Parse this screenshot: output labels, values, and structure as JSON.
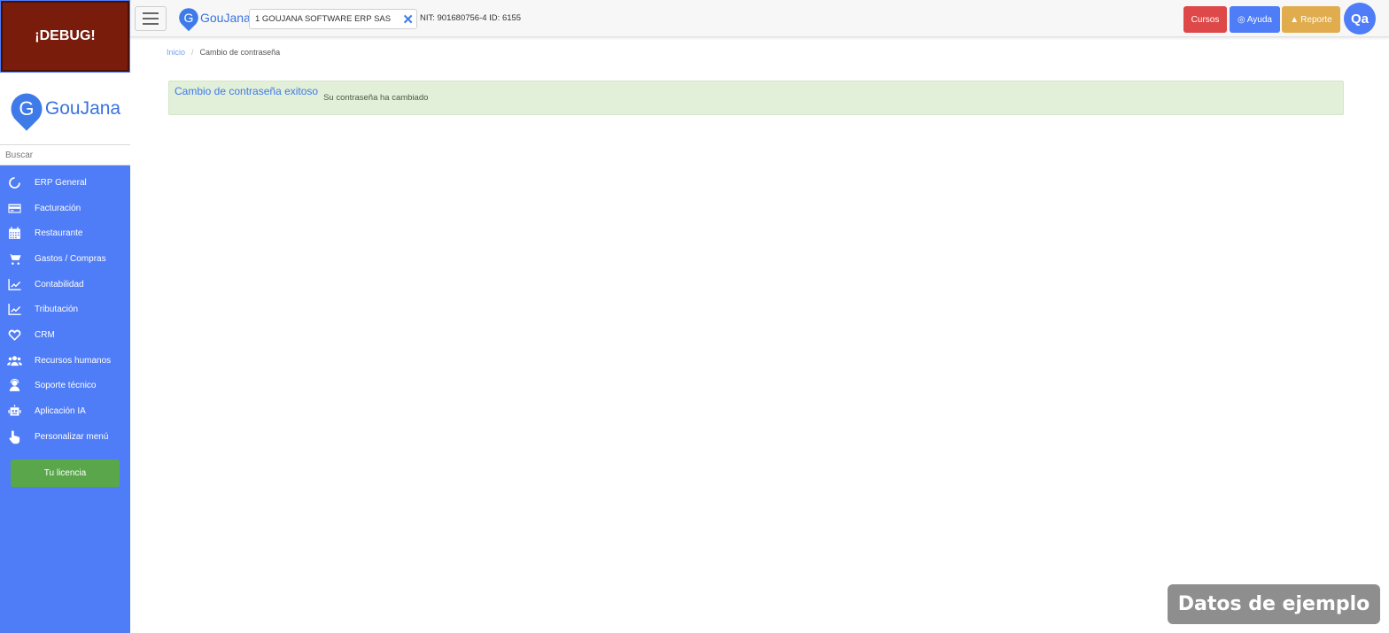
{
  "sidebar": {
    "debug_label": "¡DEBUG!",
    "logo_text": "GouJana",
    "logo_letter": "G",
    "search_placeholder": "Buscar",
    "items": [
      {
        "label": "ERP General",
        "icon": "power-circle-icon"
      },
      {
        "label": "Facturación",
        "icon": "credit-card-icon"
      },
      {
        "label": "Restaurante",
        "icon": "calendar-icon"
      },
      {
        "label": "Gastos / Compras",
        "icon": "cart-icon"
      },
      {
        "label": "Contabilidad",
        "icon": "chart-line-icon"
      },
      {
        "label": "Tributación",
        "icon": "chart-line-icon"
      },
      {
        "label": "CRM",
        "icon": "heart-icon"
      },
      {
        "label": "Recursos humanos",
        "icon": "users-icon"
      },
      {
        "label": "Soporte técnico",
        "icon": "support-user-icon"
      },
      {
        "label": "Aplicación IA",
        "icon": "robot-icon"
      },
      {
        "label": "Personalizar menú",
        "icon": "hand-pointer-icon"
      }
    ],
    "license_label": "Tu licencia"
  },
  "topbar": {
    "logo_text": "GouJana",
    "logo_letter": "G",
    "company": "1 GOUJANA SOFTWARE ERP SAS",
    "nit_info": "NIT: 901680756-4 ID: 6155",
    "cursos_label": "Cursos",
    "ayuda_label": "Ayuda",
    "reporte_label": "Reporte",
    "avatar_initials": "Qa"
  },
  "breadcrumb": {
    "home": "Inicio",
    "separator": "/",
    "current": "Cambio de contraseña"
  },
  "alert": {
    "title": "Cambio de contraseña exitoso",
    "message": "Su contraseña ha cambiado"
  },
  "watermark": "Datos de ejemplo",
  "colors": {
    "sidebar_bg": "#4f7cf7",
    "debug_bg": "#7a1c0b",
    "license_btn": "#5aa74b",
    "cursos_btn": "#de4848",
    "ayuda_btn": "#4f7cf7",
    "reporte_btn": "#e0ac4e",
    "alert_bg": "#e2efd9"
  }
}
